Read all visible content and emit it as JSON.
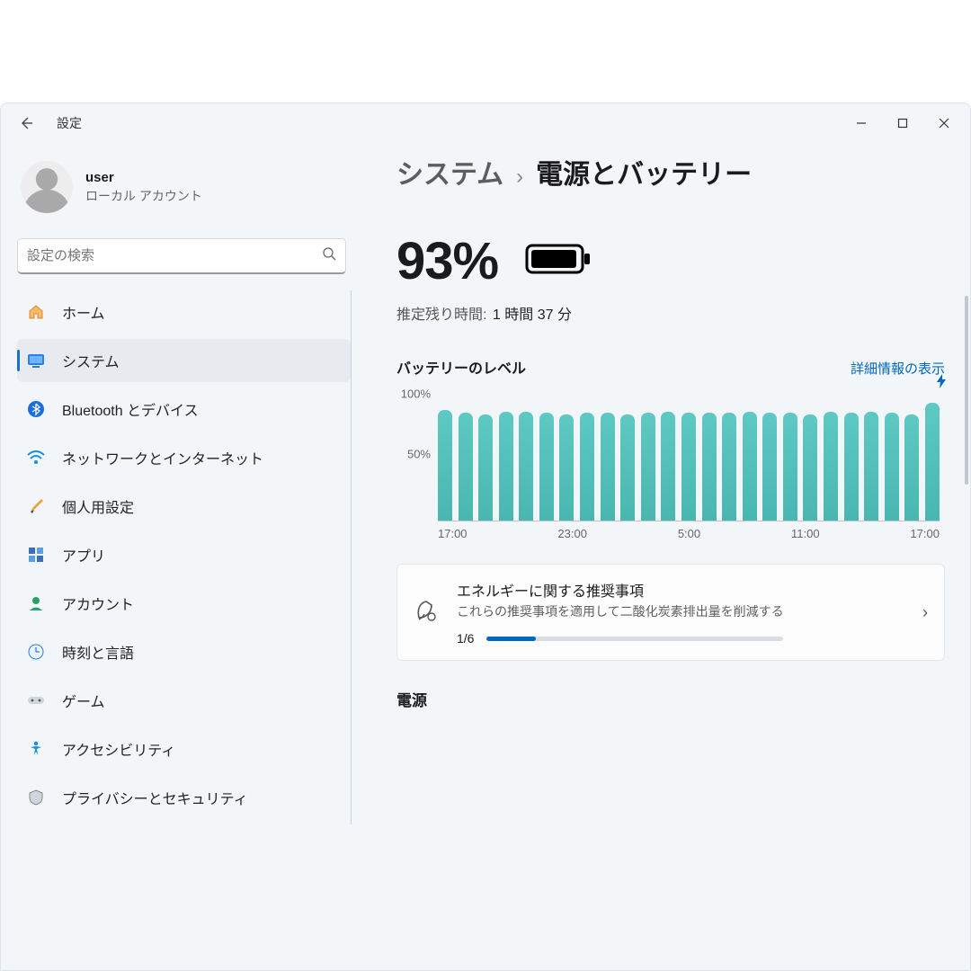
{
  "titlebar": {
    "app_title": "設定"
  },
  "user": {
    "name": "user",
    "subtitle": "ローカル アカウント"
  },
  "search": {
    "placeholder": "設定の検索"
  },
  "sidebar": {
    "items": [
      {
        "label": "ホーム"
      },
      {
        "label": "システム"
      },
      {
        "label": "Bluetooth とデバイス"
      },
      {
        "label": "ネットワークとインターネット"
      },
      {
        "label": "個人用設定"
      },
      {
        "label": "アプリ"
      },
      {
        "label": "アカウント"
      },
      {
        "label": "時刻と言語"
      },
      {
        "label": "ゲーム"
      },
      {
        "label": "アクセシビリティ"
      },
      {
        "label": "プライバシーとセキュリティ"
      }
    ],
    "active_index": 1
  },
  "breadcrumb": {
    "parent": "システム",
    "current": "電源とバッテリー"
  },
  "battery": {
    "percent_text": "93%",
    "estimate_label": "推定残り時間:",
    "estimate_value": "1 時間 37 分"
  },
  "chart": {
    "title": "バッテリーのレベル",
    "details_link": "詳細情報の表示",
    "y_ticks": {
      "top": "100%",
      "mid": "50%"
    },
    "x_ticks": [
      "17:00",
      "23:00",
      "5:00",
      "11:00",
      "17:00"
    ]
  },
  "recommend_card": {
    "title": "エネルギーに関する推奨事項",
    "subtitle": "これらの推奨事項を適用して二酸化炭素排出量を削減する",
    "count_text": "1/6",
    "progress_fraction": 0.1667
  },
  "sections": {
    "power_heading": "電源"
  },
  "chart_data": {
    "type": "bar",
    "title": "バッテリーのレベル",
    "xlabel": "",
    "ylabel": "",
    "ylim": [
      0,
      100
    ],
    "x_range": [
      "17:00",
      "17:00"
    ],
    "categories_count": 25,
    "values": [
      87,
      85,
      84,
      86,
      86,
      85,
      84,
      85,
      85,
      84,
      85,
      86,
      85,
      85,
      85,
      86,
      85,
      85,
      84,
      86,
      85,
      86,
      85,
      84,
      93
    ]
  },
  "colors": {
    "accent": "#0067c0",
    "bar": "#4ab6b1"
  }
}
